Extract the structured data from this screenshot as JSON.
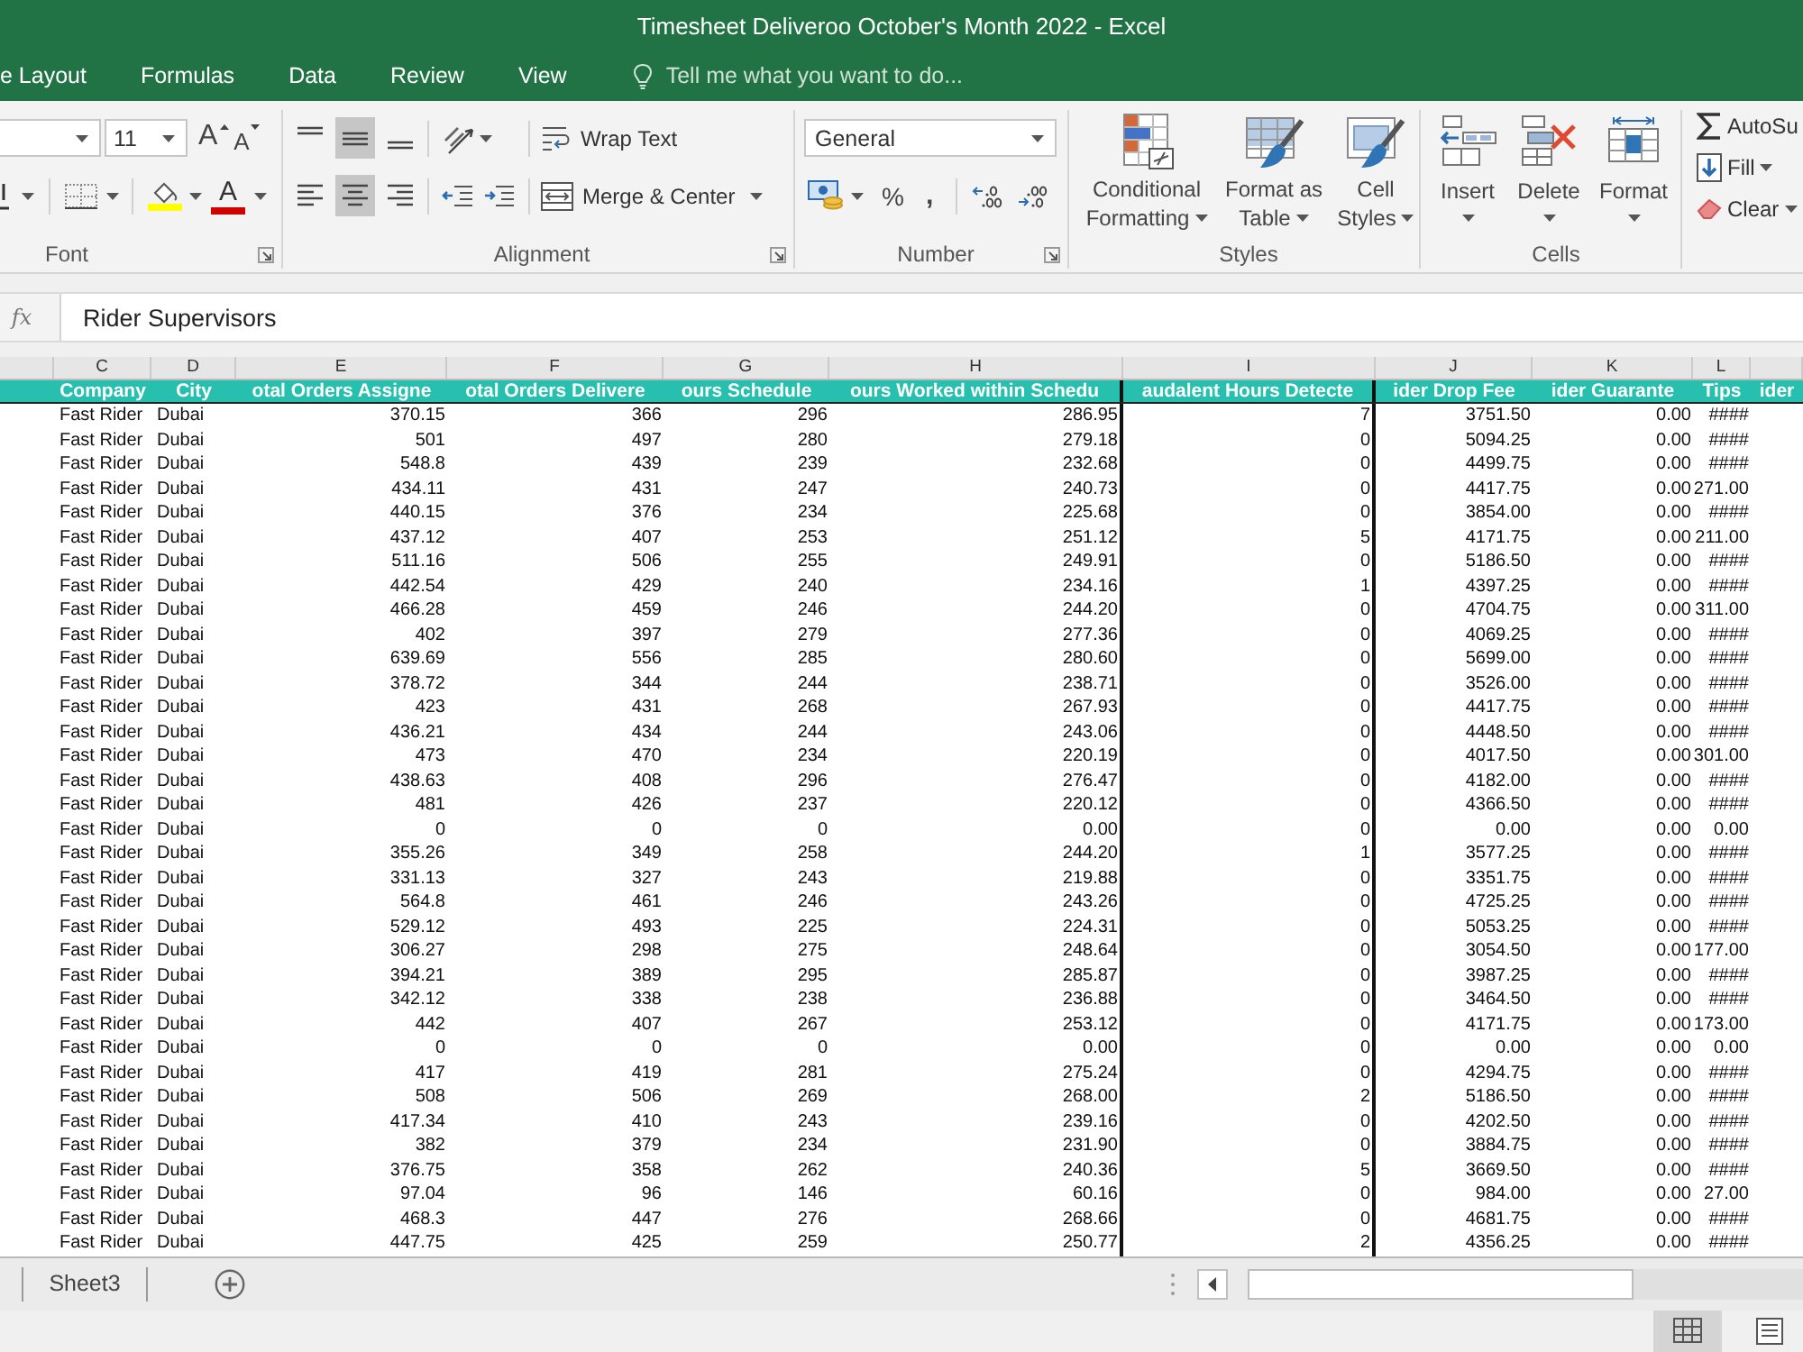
{
  "window": {
    "title": "Timesheet Deliveroo October's Month 2022 - Excel"
  },
  "ribbon_tabs": [
    {
      "label": "e Layout",
      "selected": false
    },
    {
      "label": "Formulas",
      "selected": false
    },
    {
      "label": "Data",
      "selected": false
    },
    {
      "label": "Review",
      "selected": false
    },
    {
      "label": "View",
      "selected": false
    }
  ],
  "tell_me": {
    "placeholder": "Tell me what you want to do..."
  },
  "ribbon": {
    "font": {
      "label": "Font",
      "font_size": "11",
      "grow_font": "A",
      "shrink_font": "A",
      "font_color": "A"
    },
    "alignment": {
      "label": "Alignment",
      "align_buttons": [
        {
          "kind": "top",
          "selected": false
        },
        {
          "kind": "middle",
          "selected": true
        },
        {
          "kind": "bottom",
          "selected": false
        },
        {
          "kind": "left",
          "selected": false
        },
        {
          "kind": "center",
          "selected": true
        },
        {
          "kind": "right",
          "selected": false
        }
      ],
      "wrap_text": "Wrap Text",
      "merge_center": "Merge & Center"
    },
    "number": {
      "label": "Number",
      "format": "General",
      "percent": "%",
      "comma": ","
    },
    "styles": {
      "label": "Styles",
      "buttons": [
        {
          "kind": "conditional",
          "lines": [
            "Conditional",
            "Formatting"
          ]
        },
        {
          "kind": "table",
          "lines": [
            "Format as",
            "Table"
          ]
        },
        {
          "kind": "cell_styles",
          "lines": [
            "Cell",
            "Styles"
          ]
        }
      ]
    },
    "cells": {
      "label": "Cells",
      "buttons": [
        {
          "kind": "insert",
          "label": "Insert"
        },
        {
          "kind": "delete",
          "label": "Delete"
        },
        {
          "kind": "format",
          "label": "Format"
        }
      ]
    },
    "editing": {
      "buttons": [
        {
          "kind": "autosum",
          "label": "AutoSu"
        },
        {
          "kind": "fill",
          "label": "Fill",
          "dropdown": true
        },
        {
          "kind": "clear",
          "label": "Clear",
          "dropdown": true
        }
      ]
    }
  },
  "formula_bar": {
    "function_label": "fx",
    "value": "Rider Supervisors"
  },
  "sheet": {
    "column_letters": [
      "C",
      "D",
      "E",
      "F",
      "G",
      "H",
      "I",
      "J",
      "K",
      "L"
    ],
    "headers": [
      "Company",
      "City",
      "otal Orders Assigne",
      "otal Orders Delivere",
      "ours Schedule",
      "ours Worked within Schedu",
      "audalent Hours Detecte",
      "ider Drop Fee",
      "ider Guarante",
      "Tips",
      "ider"
    ],
    "rows": [
      [
        "Fast Rider",
        "Dubai",
        "370.15",
        "366",
        "296",
        "286.95",
        "7",
        "3751.50",
        "0.00",
        "####"
      ],
      [
        "Fast Rider",
        "Dubai",
        "501",
        "497",
        "280",
        "279.18",
        "0",
        "5094.25",
        "0.00",
        "####"
      ],
      [
        "Fast Rider",
        "Dubai",
        "548.8",
        "439",
        "239",
        "232.68",
        "0",
        "4499.75",
        "0.00",
        "####"
      ],
      [
        "Fast Rider",
        "Dubai",
        "434.11",
        "431",
        "247",
        "240.73",
        "0",
        "4417.75",
        "0.00",
        "271.00"
      ],
      [
        "Fast Rider",
        "Dubai",
        "440.15",
        "376",
        "234",
        "225.68",
        "0",
        "3854.00",
        "0.00",
        "####"
      ],
      [
        "Fast Rider",
        "Dubai",
        "437.12",
        "407",
        "253",
        "251.12",
        "5",
        "4171.75",
        "0.00",
        "211.00"
      ],
      [
        "Fast Rider",
        "Dubai",
        "511.16",
        "506",
        "255",
        "249.91",
        "0",
        "5186.50",
        "0.00",
        "####"
      ],
      [
        "Fast Rider",
        "Dubai",
        "442.54",
        "429",
        "240",
        "234.16",
        "1",
        "4397.25",
        "0.00",
        "####"
      ],
      [
        "Fast Rider",
        "Dubai",
        "466.28",
        "459",
        "246",
        "244.20",
        "0",
        "4704.75",
        "0.00",
        "311.00"
      ],
      [
        "Fast Rider",
        "Dubai",
        "402",
        "397",
        "279",
        "277.36",
        "0",
        "4069.25",
        "0.00",
        "####"
      ],
      [
        "Fast Rider",
        "Dubai",
        "639.69",
        "556",
        "285",
        "280.60",
        "0",
        "5699.00",
        "0.00",
        "####"
      ],
      [
        "Fast Rider",
        "Dubai",
        "378.72",
        "344",
        "244",
        "238.71",
        "0",
        "3526.00",
        "0.00",
        "####"
      ],
      [
        "Fast Rider",
        "Dubai",
        "423",
        "431",
        "268",
        "267.93",
        "0",
        "4417.75",
        "0.00",
        "####"
      ],
      [
        "Fast Rider",
        "Dubai",
        "436.21",
        "434",
        "244",
        "243.06",
        "0",
        "4448.50",
        "0.00",
        "####"
      ],
      [
        "Fast Rider",
        "Dubai",
        "473",
        "470",
        "234",
        "220.19",
        "0",
        "4017.50",
        "0.00",
        "301.00"
      ],
      [
        "Fast Rider",
        "Dubai",
        "438.63",
        "408",
        "296",
        "276.47",
        "0",
        "4182.00",
        "0.00",
        "####"
      ],
      [
        "Fast Rider",
        "Dubai",
        "481",
        "426",
        "237",
        "220.12",
        "0",
        "4366.50",
        "0.00",
        "####"
      ],
      [
        "Fast Rider",
        "Dubai",
        "0",
        "0",
        "0",
        "0.00",
        "0",
        "0.00",
        "0.00",
        "0.00"
      ],
      [
        "Fast Rider",
        "Dubai",
        "355.26",
        "349",
        "258",
        "244.20",
        "1",
        "3577.25",
        "0.00",
        "####"
      ],
      [
        "Fast Rider",
        "Dubai",
        "331.13",
        "327",
        "243",
        "219.88",
        "0",
        "3351.75",
        "0.00",
        "####"
      ],
      [
        "Fast Rider",
        "Dubai",
        "564.8",
        "461",
        "246",
        "243.26",
        "0",
        "4725.25",
        "0.00",
        "####"
      ],
      [
        "Fast Rider",
        "Dubai",
        "529.12",
        "493",
        "225",
        "224.31",
        "0",
        "5053.25",
        "0.00",
        "####"
      ],
      [
        "Fast Rider",
        "Dubai",
        "306.27",
        "298",
        "275",
        "248.64",
        "0",
        "3054.50",
        "0.00",
        "177.00"
      ],
      [
        "Fast Rider",
        "Dubai",
        "394.21",
        "389",
        "295",
        "285.87",
        "0",
        "3987.25",
        "0.00",
        "####"
      ],
      [
        "Fast Rider",
        "Dubai",
        "342.12",
        "338",
        "238",
        "236.88",
        "0",
        "3464.50",
        "0.00",
        "####"
      ],
      [
        "Fast Rider",
        "Dubai",
        "442",
        "407",
        "267",
        "253.12",
        "0",
        "4171.75",
        "0.00",
        "173.00"
      ],
      [
        "Fast Rider",
        "Dubai",
        "0",
        "0",
        "0",
        "0.00",
        "0",
        "0.00",
        "0.00",
        "0.00"
      ],
      [
        "Fast Rider",
        "Dubai",
        "417",
        "419",
        "281",
        "275.24",
        "0",
        "4294.75",
        "0.00",
        "####"
      ],
      [
        "Fast Rider",
        "Dubai",
        "508",
        "506",
        "269",
        "268.00",
        "2",
        "5186.50",
        "0.00",
        "####"
      ],
      [
        "Fast Rider",
        "Dubai",
        "417.34",
        "410",
        "243",
        "239.16",
        "0",
        "4202.50",
        "0.00",
        "####"
      ],
      [
        "Fast Rider",
        "Dubai",
        "382",
        "379",
        "234",
        "231.90",
        "0",
        "3884.75",
        "0.00",
        "####"
      ],
      [
        "Fast Rider",
        "Dubai",
        "376.75",
        "358",
        "262",
        "240.36",
        "5",
        "3669.50",
        "0.00",
        "####"
      ],
      [
        "Fast Rider",
        "Dubai",
        "97.04",
        "96",
        "146",
        "60.16",
        "0",
        "984.00",
        "0.00",
        "27.00"
      ],
      [
        "Fast Rider",
        "Dubai",
        "468.3",
        "447",
        "276",
        "268.66",
        "0",
        "4681.75",
        "0.00",
        "####"
      ],
      [
        "Fast Rider",
        "Dubai",
        "447.75",
        "425",
        "259",
        "250.77",
        "2",
        "4356.25",
        "0.00",
        "####"
      ]
    ]
  },
  "sheet_tabs": [
    {
      "label": "Sheet3",
      "selected": false
    }
  ],
  "status_bar": {
    "views": [
      {
        "kind": "normal",
        "selected": true
      },
      {
        "kind": "page_layout",
        "selected": false
      }
    ]
  }
}
